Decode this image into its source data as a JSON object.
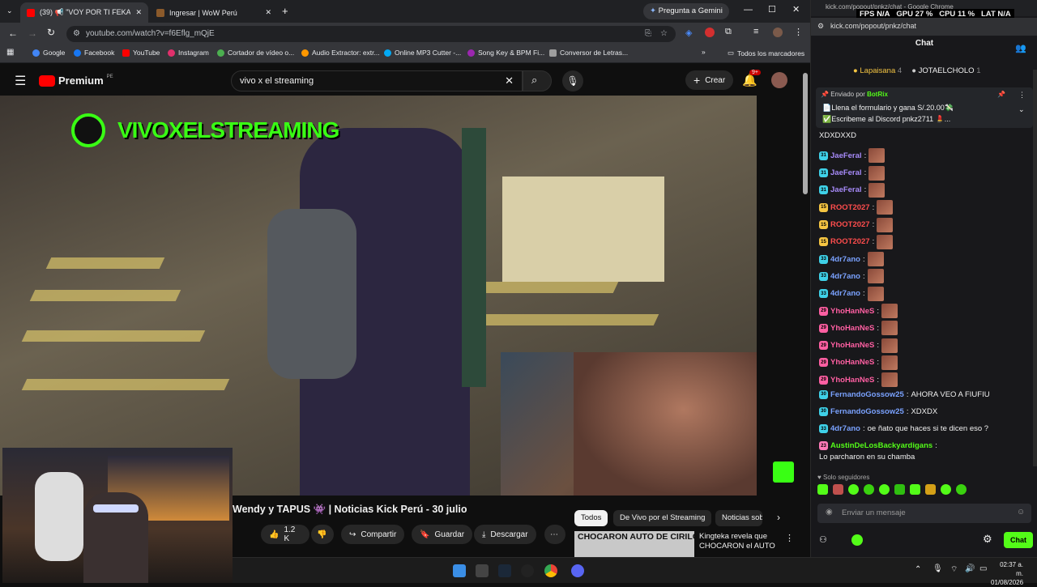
{
  "browser": {
    "tabs": [
      {
        "label": "(39) 📢 \"VOY POR TI FEKA\"",
        "active": true
      },
      {
        "label": "Ingresar | WoW Perú",
        "active": false
      }
    ],
    "gemini_label": "Pregunta a Gemini",
    "url": "youtube.com/watch?v=f6Eflg_mQjE",
    "bookmarks": [
      "Google",
      "Facebook",
      "YouTube",
      "Instagram",
      "Cortador de vídeo o...",
      "Audio Extractor: extr...",
      "Online MP3 Cutter -...",
      "Song Key & BPM Fi...",
      "Conversor de Letras..."
    ],
    "all_bookmarks": "Todos los marcadores"
  },
  "youtube": {
    "brand": "Premium",
    "brand_region": "PE",
    "search_value": "vivo x el streaming",
    "create_label": "Crear",
    "notif_count": "9+",
    "overlay_text": "VIVOXELSTREAMING",
    "video_title": "Wendy y TAPUS 👾 | Noticias Kick Perú - 30 julio",
    "like_count": "1.2 K",
    "share_label": "Compartir",
    "save_label": "Guardar",
    "download_label": "Descargar",
    "chips": [
      "Todos",
      "De Vivo por el Streaming",
      "Noticias sob"
    ],
    "rec_thumb_text": "CHOCARON AUTO DE CIRILO",
    "rec_title": "Kingteka revela que CHOCARON el AUTO ..."
  },
  "kick": {
    "window_title": "kick.com/popout/pnkz/chat - Google Chrome",
    "stats": {
      "fps_label": "FPS",
      "fps": "N/A",
      "gpu_label": "GPU",
      "gpu": "27 %",
      "cpu_label": "CPU",
      "cpu": "11 %",
      "lat_label": "LAT",
      "lat": "N/A"
    },
    "url": "kick.com/popout/pnkz/chat",
    "header": "Chat",
    "gifters": [
      {
        "name": "Lapaisana",
        "count": "4"
      },
      {
        "name": "JOTAELCHOLO",
        "count": "1"
      }
    ],
    "pinned_by_label": "Enviado por",
    "pinned_by": "BotRix",
    "pinned_lines": [
      "📄Llena el formulario y gana S/.20.00💸",
      "✅Escribeme al Discord pnkz2711 💄..."
    ],
    "messages": [
      {
        "badge": "",
        "user": "",
        "color": "#ffffff",
        "text": "XDXDXXD",
        "emote": false
      },
      {
        "badge": "31",
        "user": "JaeFeral",
        "color": "#a78bfa",
        "text": "",
        "emote": true
      },
      {
        "badge": "31",
        "user": "JaeFeral",
        "color": "#a78bfa",
        "text": "",
        "emote": true
      },
      {
        "badge": "31",
        "user": "JaeFeral",
        "color": "#a78bfa",
        "text": "",
        "emote": true
      },
      {
        "badge": "15",
        "user": "ROOT2027",
        "color": "#ff4d4d",
        "text": "",
        "emote": true
      },
      {
        "badge": "15",
        "user": "ROOT2027",
        "color": "#ff4d4d",
        "text": "",
        "emote": true
      },
      {
        "badge": "15",
        "user": "ROOT2027",
        "color": "#ff4d4d",
        "text": "",
        "emote": true
      },
      {
        "badge": "33",
        "user": "4dr7ano",
        "color": "#7aa2ff",
        "text": "",
        "emote": true
      },
      {
        "badge": "33",
        "user": "4dr7ano",
        "color": "#7aa2ff",
        "text": "",
        "emote": true
      },
      {
        "badge": "33",
        "user": "4dr7ano",
        "color": "#7aa2ff",
        "text": "",
        "emote": true
      },
      {
        "badge": "29",
        "user": "YhoHanNeS",
        "color": "#ff5fa2",
        "text": "",
        "emote": true
      },
      {
        "badge": "29",
        "user": "YhoHanNeS",
        "color": "#ff5fa2",
        "text": "",
        "emote": true
      },
      {
        "badge": "29",
        "user": "YhoHanNeS",
        "color": "#ff5fa2",
        "text": "",
        "emote": true
      },
      {
        "badge": "29",
        "user": "YhoHanNeS",
        "color": "#ff5fa2",
        "text": "",
        "emote": true
      },
      {
        "badge": "29",
        "user": "YhoHanNeS",
        "color": "#ff5fa2",
        "text": "",
        "emote": true
      },
      {
        "badge": "30",
        "user": "FernandoGossow25",
        "color": "#7aa2ff",
        "text": "AHORA VEO A FIUFIU",
        "emote": false
      },
      {
        "badge": "30",
        "user": "FernandoGossow25",
        "color": "#7aa2ff",
        "text": "XDXDX",
        "emote": false
      },
      {
        "badge": "33",
        "user": "4dr7ano",
        "color": "#7aa2ff",
        "text": "oe ñato que haces si te dicen eso ?",
        "emote": false
      },
      {
        "badge": "23",
        "user": "AustinDeLosBackyardigans",
        "color": "#53fc18",
        "text": "Lo parcharon en su chamba",
        "emote": false
      }
    ],
    "followers_only": "Solo seguidores",
    "input_placeholder": "Enviar un mensaje",
    "chat_button": "Chat"
  },
  "taskbar": {
    "time": "02:37 a. m.",
    "date": "01/08/2026"
  }
}
